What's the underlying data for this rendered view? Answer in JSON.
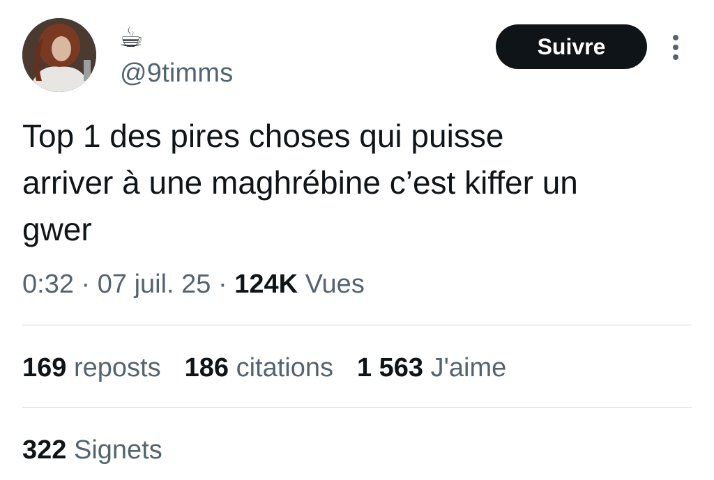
{
  "author": {
    "display_name": "☕",
    "handle": "@9timms"
  },
  "follow_label": "Suivre",
  "tweet": {
    "text": "Top 1 des pires choses qui puisse\narriver à une maghrébine c’est kiffer un\ngwer",
    "time": "0:32",
    "separator": "·",
    "date": "07 juil. 25",
    "views_count": "124K",
    "views_label": "Vues"
  },
  "stats": {
    "reposts": {
      "count": "169",
      "label": "reposts"
    },
    "quotes": {
      "count": "186",
      "label": "citations"
    },
    "likes": {
      "count": "1 563",
      "label": "J'aime"
    },
    "bookmarks": {
      "count": "322",
      "label": "Signets"
    }
  },
  "colors": {
    "text": "#0f1419",
    "secondary": "#536471",
    "divider": "#cfd9de",
    "button_bg": "#0f1419"
  },
  "icons": {
    "more": "more-vertical-icon",
    "avatar": "avatar"
  }
}
